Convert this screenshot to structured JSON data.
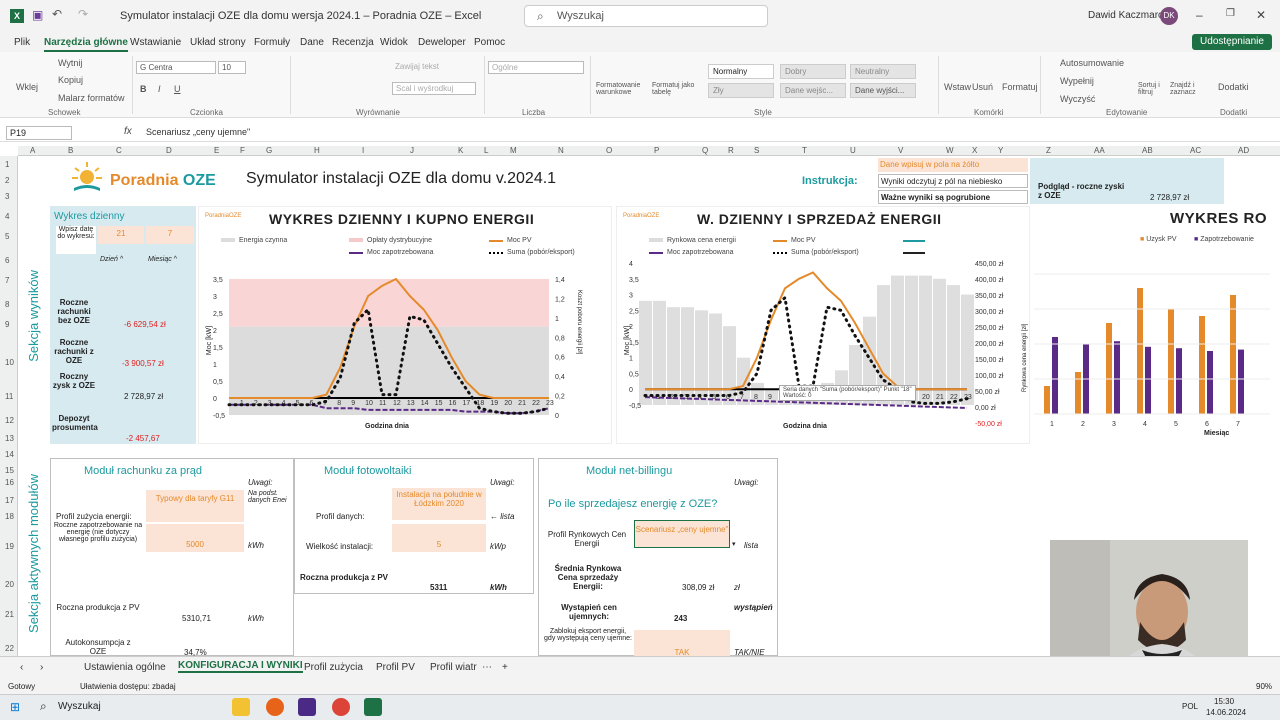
{
  "titlebar": {
    "title": "Symulator instalacji OZE dla domu wersja 2024.1 – Poradnia OZE – Excel",
    "search_placeholder": "Wyszukaj",
    "user": "Dawid Kaczmarczyk",
    "user_initials": "DK"
  },
  "menu": [
    "Plik",
    "Narzędzia główne",
    "Wstawianie",
    "Układ strony",
    "Formuły",
    "Dane",
    "Recenzja",
    "Widok",
    "Deweloper",
    "Pomoc"
  ],
  "share": "Udostępnianie",
  "ribbon": {
    "cut": "Wytnij",
    "copy": "Kopiuj",
    "painter": "Malarz formatów",
    "paste": "Wklej",
    "font": "G Centra",
    "size": "10",
    "wrap": "Zawijaj tekst",
    "merge": "Scal i wyśrodkuj",
    "numfmt": "Ogólne",
    "cond": "Formatowanie warunkowe",
    "table": "Formatuj jako tabelę",
    "styles": [
      "Normalny",
      "Dobry",
      "Neutralny",
      "Zły",
      "Dane wejśc...",
      "Dane wyjści..."
    ],
    "insert": "Wstaw",
    "delete": "Usuń",
    "format": "Formatuj",
    "autosum": "Autosumowanie",
    "fill": "Wypełnij",
    "clear": "Wyczyść",
    "sort": "Sortuj i filtruj",
    "find": "Znajdź i zaznacz",
    "addins": "Dodatki",
    "groups": [
      "Schowek",
      "Czcionka",
      "Wyrównanie",
      "Liczba",
      "Style",
      "Komórki",
      "Edytowanie",
      "Dodatki"
    ]
  },
  "formula": {
    "namebox": "P19",
    "fx": "fx",
    "content": "Scenariusz „ceny ujemne\""
  },
  "columns": [
    "A",
    "B",
    "C",
    "D",
    "E",
    "F",
    "G",
    "H",
    "I",
    "J",
    "K",
    "L",
    "M",
    "N",
    "O",
    "P",
    "Q",
    "R",
    "S",
    "T",
    "U",
    "V",
    "W",
    "X",
    "Y",
    "Z",
    "AA",
    "AB",
    "AC",
    "AD"
  ],
  "rows": [
    "1",
    "2",
    "3",
    "4",
    "5",
    "6",
    "7",
    "8",
    "9",
    "10",
    "11",
    "12",
    "13",
    "14",
    "15",
    "16",
    "17",
    "18",
    "19",
    "20",
    "21",
    "22"
  ],
  "header": {
    "logo": "Poradnia",
    "logo2": "OZE",
    "title": "Symulator instalacji OZE dla domu v.2024.1",
    "instr_label": "Instrukcja:",
    "instr1": "Dane wpisuj w pola na żółto",
    "instr2": "Wyniki odczytuj z pól na niebiesko",
    "instr3": "Ważne wyniki są pogrubione",
    "preview_label": "Podgląd - roczne zyski z OZE",
    "preview_value": "2 728,97 zł"
  },
  "results": {
    "section_label": "Sekcja wyników",
    "daily": "Wykres dzienny",
    "pick_date": "Wpisz datę do wykresu:",
    "day_val": "21",
    "month_val": "7",
    "day_lbl": "Dzień ^",
    "month_lbl": "Miesiąc ^",
    "r1_lbl": "Roczne rachunki bez OZE",
    "r1_val": "-6 629,54 zł",
    "r2_lbl": "Roczne rachunki z OZE",
    "r2_val": "-3 900,57 zł",
    "r3_lbl": "Roczny zysk z OZE",
    "r3_val": "2 728,97 zł",
    "r4_lbl": "Depozyt prosumenta",
    "r4_val": "-2 457,67"
  },
  "chart1": {
    "logo": "PoradniaOZE",
    "title": "WYKRES DZIENNY I KUPNO ENERGII",
    "legend": [
      "Energia czynna",
      "Opłaty dystrybucyjne",
      "Moc PV",
      "Moc zapotrzebowana",
      "Suma (pobór/eksport)"
    ],
    "yleft": [
      "3,5",
      "3",
      "2,5",
      "2",
      "1,5",
      "1",
      "0,5",
      "0",
      "-0,5"
    ],
    "yright": [
      "1,4",
      "1,2",
      "1",
      "0,8",
      "0,6",
      "0,4",
      "0,2",
      "0"
    ],
    "xlabels": [
      "1",
      "2",
      "3",
      "4",
      "5",
      "6",
      "7",
      "8",
      "9",
      "10",
      "11",
      "12",
      "13",
      "14",
      "15",
      "16",
      "17",
      "18",
      "19",
      "20",
      "21",
      "22",
      "23"
    ],
    "xlabel": "Godzina dnia",
    "ylabel": "Moc [kW]",
    "y2label": "Koszt poboru energii [zł]"
  },
  "chart2": {
    "logo": "PoradniaOZE",
    "title": "W. DZIENNY I SPRZEDAŻ ENERGII",
    "legend": [
      "Rynkowa cena energii",
      "Moc PV",
      "Moc zapotrzebowana",
      "Suma (pobór/eksport)"
    ],
    "yleft": [
      "4",
      "3,5",
      "3",
      "2,5",
      "2",
      "1,5",
      "1",
      "0,5",
      "0",
      "-0,5"
    ],
    "yright": [
      "450,00 zł",
      "400,00 zł",
      "350,00 zł",
      "300,00 zł",
      "250,00 zł",
      "200,00 zł",
      "150,00 zł",
      "100,00 zł",
      "50,00 zł",
      "0,00 zł",
      "-50,00 zł"
    ],
    "xlabel": "Godzina dnia",
    "ylabel": "Moc [kW]",
    "y2label": "Rynkowa cena energii [zł]",
    "tooltip": "Seria danych \"Suma (pobór/eksport)\" Punkt \"18\"",
    "tooltip2": "Wartość: 0"
  },
  "chart3": {
    "title": "WYKRES RO",
    "legend": [
      "Uzysk PV",
      "Zapotrzebowanie"
    ],
    "xlabel": "Miesiąc",
    "xlabels": [
      "1",
      "2",
      "3",
      "4",
      "5",
      "6",
      "7"
    ]
  },
  "chart_data": [
    {
      "type": "line",
      "title": "WYKRES DZIENNY I KUPNO ENERGII",
      "xlabel": "Godzina dnia",
      "ylabel": "Moc [kW]",
      "x": [
        0,
        1,
        2,
        3,
        4,
        5,
        6,
        7,
        8,
        9,
        10,
        11,
        12,
        13,
        14,
        15,
        16,
        17,
        18,
        19,
        20,
        21,
        22,
        23
      ],
      "ylim": [
        -0.5,
        3.5
      ],
      "series": [
        {
          "name": "Moc PV",
          "values": [
            0,
            0,
            0,
            0,
            0,
            0,
            0,
            0.1,
            0.9,
            2.1,
            3.0,
            3.3,
            3.5,
            3.0,
            2.6,
            2.0,
            1.2,
            0.5,
            0.1,
            0,
            0,
            0,
            0,
            0
          ]
        },
        {
          "name": "Moc zapotrzebowana",
          "values": [
            -0.2,
            -0.2,
            -0.2,
            -0.2,
            -0.2,
            -0.2,
            -0.2,
            -0.3,
            -0.3,
            -0.3,
            -0.35,
            -0.35,
            -0.35,
            -0.35,
            -0.35,
            -0.35,
            -0.35,
            -0.4,
            -0.4,
            -0.4,
            -0.45,
            -0.45,
            -0.4,
            -0.3
          ]
        },
        {
          "name": "Suma (pobór/eksport)",
          "values": [
            -0.2,
            -0.2,
            -0.2,
            -0.2,
            -0.2,
            -0.2,
            -0.2,
            -0.1,
            0.6,
            2.2,
            2.6,
            0.1,
            0.1,
            2.4,
            2.3,
            1.6,
            0.9,
            0.3,
            -0.3,
            -0.4,
            -0.45,
            -0.45,
            -0.4,
            -0.3
          ]
        }
      ]
    },
    {
      "type": "line",
      "title": "W. DZIENNY I SPRZEDAŻ ENERGII",
      "xlabel": "Godzina dnia",
      "ylabel": "Moc [kW]",
      "x": [
        0,
        1,
        2,
        3,
        4,
        5,
        6,
        7,
        8,
        9,
        10,
        11,
        12,
        13,
        14,
        15,
        16,
        17,
        18,
        19,
        20,
        21,
        22,
        23
      ],
      "ylim": [
        -0.5,
        4
      ],
      "series": [
        {
          "name": "Moc PV",
          "values": [
            0,
            0,
            0,
            0,
            0,
            0,
            0,
            0.1,
            1.0,
            2.2,
            3.2,
            3.5,
            3.7,
            3.2,
            2.8,
            2.1,
            1.3,
            0.5,
            0.1,
            0,
            0,
            0,
            0,
            0
          ]
        },
        {
          "name": "Suma (pobór/eksport)",
          "values": [
            -0.2,
            -0.2,
            -0.2,
            -0.2,
            -0.2,
            -0.2,
            -0.2,
            -0.1,
            0.5,
            2.5,
            2.9,
            0.1,
            0.1,
            2.6,
            2.5,
            1.7,
            1.0,
            0.3,
            0,
            -0.4,
            -0.45,
            -0.45,
            -0.4,
            -0.3
          ]
        }
      ]
    },
    {
      "type": "bar",
      "title": "WYKRES RO",
      "xlabel": "Miesiąc",
      "categories": [
        "1",
        "2",
        "3",
        "4",
        "5",
        "6",
        "7"
      ],
      "series": [
        {
          "name": "Uzysk PV",
          "values": [
            20,
            30,
            65,
            90,
            75,
            70,
            85
          ]
        },
        {
          "name": "Zapotrzebowanie",
          "values": [
            55,
            50,
            52,
            48,
            47,
            45,
            46
          ]
        }
      ]
    }
  ],
  "modules": {
    "section_label": "Sekcja aktywnych modułów",
    "m1": {
      "title": "Moduł rachunku za prąd",
      "note_hdr": "Uwagi:",
      "profile_lbl": "Profil zużycia energii:",
      "profile_val": "Typowy dla taryfy G11",
      "profile_note": "Na podst. danych Enei",
      "annual_lbl": "Roczne zapotrzebowanie na energię (nie dotyczy własnego profilu zużycia)",
      "annual_val": "5000",
      "annual_unit": "kWh",
      "prod_lbl": "Roczna produkcja z PV",
      "prod_val": "5310,71",
      "prod_unit": "kWh",
      "auto_lbl": "Autokonsumpcja z OZE",
      "auto_val": "34,7%"
    },
    "m2": {
      "title": "Moduł fotowoltaiki",
      "note_hdr": "Uwagi:",
      "profile_lbl": "Profil danych:",
      "profile_val": "Instalacja na południe w Łódzkim 2020",
      "profile_note": "← lista",
      "size_lbl": "Wielkość instalacji:",
      "size_val": "5",
      "size_unit": "kWp",
      "prod_lbl": "Roczna produkcja z PV",
      "prod_val": "5311",
      "prod_unit": "kWh"
    },
    "m3": {
      "title": "Moduł net-billingu",
      "note_hdr": "Uwagi:",
      "question": "Po ile sprzedajesz energię z OZE?",
      "profile_lbl": "Profil Rynkowych Cen Energii",
      "profile_val": "Scenariusz „ceny ujemne\"",
      "profile_note": "lista",
      "avg_lbl": "Średnia Rynkowa Cena sprzedaży Energii:",
      "avg_val": "308,09 zł",
      "avg_unit": "zł",
      "neg_lbl": "Wystąpień cen ujemnych:",
      "neg_val": "243",
      "neg_unit": "wystąpień",
      "block_lbl": "Zablokuj eksport energii, gdy występują ceny ujemne:",
      "block_val": "TAK",
      "block_note": "TAK/NIE"
    }
  },
  "sheets": [
    "Ustawienia ogólne",
    "KONFIGURACJA I WYNIKI",
    "Profil zużycia",
    "Profil PV",
    "Profil wiatr"
  ],
  "status": {
    "ready": "Gotowy",
    "access": "Ułatwienia dostępu: zbadaj",
    "zoom": "90%"
  },
  "taskbar": {
    "search": "Wyszukaj",
    "lang": "POL",
    "time": "15:30",
    "date": "14.06.2024"
  },
  "colors": {
    "excel_green": "#1e7145",
    "teal": "#1c9aa0",
    "orange": "#e58a2b",
    "purple": "#5b2a86",
    "blue_fill": "#d6eaf0",
    "peach_fill": "#fbe4d5"
  }
}
